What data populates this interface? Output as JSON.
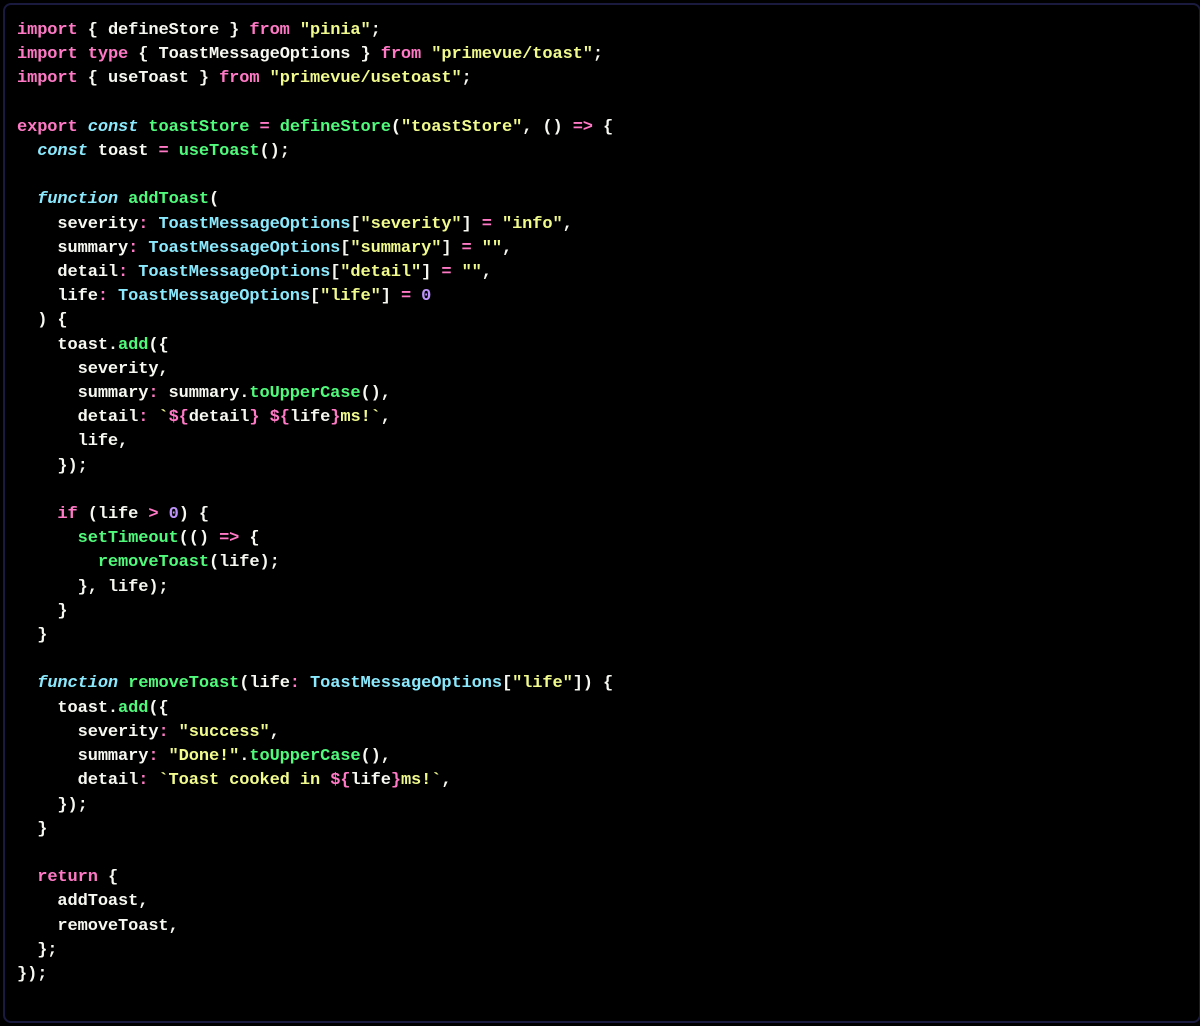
{
  "code": {
    "lines": [
      {
        "tokens": [
          {
            "t": "import",
            "c": "kw"
          },
          {
            "t": " { ",
            "c": "pun"
          },
          {
            "t": "defineStore",
            "c": "id"
          },
          {
            "t": " } ",
            "c": "pun"
          },
          {
            "t": "from",
            "c": "kw"
          },
          {
            "t": " ",
            "c": "pun"
          },
          {
            "t": "\"pinia\"",
            "c": "str"
          },
          {
            "t": ";",
            "c": "pun"
          }
        ]
      },
      {
        "tokens": [
          {
            "t": "import",
            "c": "kw"
          },
          {
            "t": " ",
            "c": "pun"
          },
          {
            "t": "type",
            "c": "kw"
          },
          {
            "t": " { ",
            "c": "pun"
          },
          {
            "t": "ToastMessageOptions",
            "c": "id"
          },
          {
            "t": " } ",
            "c": "pun"
          },
          {
            "t": "from",
            "c": "kw"
          },
          {
            "t": " ",
            "c": "pun"
          },
          {
            "t": "\"primevue/toast\"",
            "c": "str"
          },
          {
            "t": ";",
            "c": "pun"
          }
        ]
      },
      {
        "tokens": [
          {
            "t": "import",
            "c": "kw"
          },
          {
            "t": " { ",
            "c": "pun"
          },
          {
            "t": "useToast",
            "c": "id"
          },
          {
            "t": " } ",
            "c": "pun"
          },
          {
            "t": "from",
            "c": "kw"
          },
          {
            "t": " ",
            "c": "pun"
          },
          {
            "t": "\"primevue/usetoast\"",
            "c": "str"
          },
          {
            "t": ";",
            "c": "pun"
          }
        ]
      },
      {
        "tokens": [
          {
            "t": "",
            "c": "pun"
          }
        ]
      },
      {
        "tokens": [
          {
            "t": "export",
            "c": "kw"
          },
          {
            "t": " ",
            "c": "pun"
          },
          {
            "t": "const",
            "c": "sk"
          },
          {
            "t": " ",
            "c": "pun"
          },
          {
            "t": "toastStore",
            "c": "fn"
          },
          {
            "t": " ",
            "c": "pun"
          },
          {
            "t": "=",
            "c": "kw"
          },
          {
            "t": " ",
            "c": "pun"
          },
          {
            "t": "defineStore",
            "c": "fn"
          },
          {
            "t": "(",
            "c": "pun"
          },
          {
            "t": "\"toastStore\"",
            "c": "str"
          },
          {
            "t": ", () ",
            "c": "pun"
          },
          {
            "t": "=>",
            "c": "kw"
          },
          {
            "t": " {",
            "c": "pun"
          }
        ]
      },
      {
        "tokens": [
          {
            "t": "  ",
            "c": "pun"
          },
          {
            "t": "const",
            "c": "sk"
          },
          {
            "t": " ",
            "c": "pun"
          },
          {
            "t": "toast",
            "c": "id"
          },
          {
            "t": " ",
            "c": "pun"
          },
          {
            "t": "=",
            "c": "kw"
          },
          {
            "t": " ",
            "c": "pun"
          },
          {
            "t": "useToast",
            "c": "fn"
          },
          {
            "t": "();",
            "c": "pun"
          }
        ]
      },
      {
        "tokens": [
          {
            "t": "",
            "c": "pun"
          }
        ]
      },
      {
        "tokens": [
          {
            "t": "  ",
            "c": "pun"
          },
          {
            "t": "function",
            "c": "sk"
          },
          {
            "t": " ",
            "c": "pun"
          },
          {
            "t": "addToast",
            "c": "fn"
          },
          {
            "t": "(",
            "c": "pun"
          }
        ]
      },
      {
        "tokens": [
          {
            "t": "    severity",
            "c": "id"
          },
          {
            "t": ":",
            "c": "kw"
          },
          {
            "t": " ",
            "c": "pun"
          },
          {
            "t": "ToastMessageOptions",
            "c": "type"
          },
          {
            "t": "[",
            "c": "pun"
          },
          {
            "t": "\"severity\"",
            "c": "str"
          },
          {
            "t": "] ",
            "c": "pun"
          },
          {
            "t": "=",
            "c": "kw"
          },
          {
            "t": " ",
            "c": "pun"
          },
          {
            "t": "\"info\"",
            "c": "str"
          },
          {
            "t": ",",
            "c": "pun"
          }
        ]
      },
      {
        "tokens": [
          {
            "t": "    summary",
            "c": "id"
          },
          {
            "t": ":",
            "c": "kw"
          },
          {
            "t": " ",
            "c": "pun"
          },
          {
            "t": "ToastMessageOptions",
            "c": "type"
          },
          {
            "t": "[",
            "c": "pun"
          },
          {
            "t": "\"summary\"",
            "c": "str"
          },
          {
            "t": "] ",
            "c": "pun"
          },
          {
            "t": "=",
            "c": "kw"
          },
          {
            "t": " ",
            "c": "pun"
          },
          {
            "t": "\"\"",
            "c": "str"
          },
          {
            "t": ",",
            "c": "pun"
          }
        ]
      },
      {
        "tokens": [
          {
            "t": "    detail",
            "c": "id"
          },
          {
            "t": ":",
            "c": "kw"
          },
          {
            "t": " ",
            "c": "pun"
          },
          {
            "t": "ToastMessageOptions",
            "c": "type"
          },
          {
            "t": "[",
            "c": "pun"
          },
          {
            "t": "\"detail\"",
            "c": "str"
          },
          {
            "t": "] ",
            "c": "pun"
          },
          {
            "t": "=",
            "c": "kw"
          },
          {
            "t": " ",
            "c": "pun"
          },
          {
            "t": "\"\"",
            "c": "str"
          },
          {
            "t": ",",
            "c": "pun"
          }
        ]
      },
      {
        "tokens": [
          {
            "t": "    life",
            "c": "id"
          },
          {
            "t": ":",
            "c": "kw"
          },
          {
            "t": " ",
            "c": "pun"
          },
          {
            "t": "ToastMessageOptions",
            "c": "type"
          },
          {
            "t": "[",
            "c": "pun"
          },
          {
            "t": "\"life\"",
            "c": "str"
          },
          {
            "t": "] ",
            "c": "pun"
          },
          {
            "t": "=",
            "c": "kw"
          },
          {
            "t": " ",
            "c": "pun"
          },
          {
            "t": "0",
            "c": "num"
          }
        ]
      },
      {
        "tokens": [
          {
            "t": "  ) {",
            "c": "pun"
          }
        ]
      },
      {
        "tokens": [
          {
            "t": "    toast.",
            "c": "id"
          },
          {
            "t": "add",
            "c": "fn"
          },
          {
            "t": "({",
            "c": "pun"
          }
        ]
      },
      {
        "tokens": [
          {
            "t": "      severity,",
            "c": "id"
          }
        ]
      },
      {
        "tokens": [
          {
            "t": "      summary",
            "c": "id"
          },
          {
            "t": ":",
            "c": "kw"
          },
          {
            "t": " summary.",
            "c": "id"
          },
          {
            "t": "toUpperCase",
            "c": "fn"
          },
          {
            "t": "(),",
            "c": "pun"
          }
        ]
      },
      {
        "tokens": [
          {
            "t": "      detail",
            "c": "id"
          },
          {
            "t": ":",
            "c": "kw"
          },
          {
            "t": " ",
            "c": "pun"
          },
          {
            "t": "`",
            "c": "tpl"
          },
          {
            "t": "${",
            "c": "kw"
          },
          {
            "t": "detail",
            "c": "id"
          },
          {
            "t": "}",
            "c": "kw"
          },
          {
            "t": " ",
            "c": "tpl"
          },
          {
            "t": "${",
            "c": "kw"
          },
          {
            "t": "life",
            "c": "id"
          },
          {
            "t": "}",
            "c": "kw"
          },
          {
            "t": "ms!`",
            "c": "tpl"
          },
          {
            "t": ",",
            "c": "pun"
          }
        ]
      },
      {
        "tokens": [
          {
            "t": "      life,",
            "c": "id"
          }
        ]
      },
      {
        "tokens": [
          {
            "t": "    });",
            "c": "pun"
          }
        ]
      },
      {
        "tokens": [
          {
            "t": "",
            "c": "pun"
          }
        ]
      },
      {
        "tokens": [
          {
            "t": "    ",
            "c": "pun"
          },
          {
            "t": "if",
            "c": "kw"
          },
          {
            "t": " (life ",
            "c": "pun"
          },
          {
            "t": ">",
            "c": "kw"
          },
          {
            "t": " ",
            "c": "pun"
          },
          {
            "t": "0",
            "c": "num"
          },
          {
            "t": ") {",
            "c": "pun"
          }
        ]
      },
      {
        "tokens": [
          {
            "t": "      ",
            "c": "pun"
          },
          {
            "t": "setTimeout",
            "c": "fn"
          },
          {
            "t": "(() ",
            "c": "pun"
          },
          {
            "t": "=>",
            "c": "kw"
          },
          {
            "t": " {",
            "c": "pun"
          }
        ]
      },
      {
        "tokens": [
          {
            "t": "        ",
            "c": "pun"
          },
          {
            "t": "removeToast",
            "c": "fn"
          },
          {
            "t": "(life);",
            "c": "pun"
          }
        ]
      },
      {
        "tokens": [
          {
            "t": "      }, life);",
            "c": "pun"
          }
        ]
      },
      {
        "tokens": [
          {
            "t": "    }",
            "c": "pun"
          }
        ]
      },
      {
        "tokens": [
          {
            "t": "  }",
            "c": "pun"
          }
        ]
      },
      {
        "tokens": [
          {
            "t": "",
            "c": "pun"
          }
        ]
      },
      {
        "tokens": [
          {
            "t": "  ",
            "c": "pun"
          },
          {
            "t": "function",
            "c": "sk"
          },
          {
            "t": " ",
            "c": "pun"
          },
          {
            "t": "removeToast",
            "c": "fn"
          },
          {
            "t": "(life",
            "c": "pun"
          },
          {
            "t": ":",
            "c": "kw"
          },
          {
            "t": " ",
            "c": "pun"
          },
          {
            "t": "ToastMessageOptions",
            "c": "type"
          },
          {
            "t": "[",
            "c": "pun"
          },
          {
            "t": "\"life\"",
            "c": "str"
          },
          {
            "t": "]) {",
            "c": "pun"
          }
        ]
      },
      {
        "tokens": [
          {
            "t": "    toast.",
            "c": "id"
          },
          {
            "t": "add",
            "c": "fn"
          },
          {
            "t": "({",
            "c": "pun"
          }
        ]
      },
      {
        "tokens": [
          {
            "t": "      severity",
            "c": "id"
          },
          {
            "t": ":",
            "c": "kw"
          },
          {
            "t": " ",
            "c": "pun"
          },
          {
            "t": "\"success\"",
            "c": "str"
          },
          {
            "t": ",",
            "c": "pun"
          }
        ]
      },
      {
        "tokens": [
          {
            "t": "      summary",
            "c": "id"
          },
          {
            "t": ":",
            "c": "kw"
          },
          {
            "t": " ",
            "c": "pun"
          },
          {
            "t": "\"Done!\"",
            "c": "str"
          },
          {
            "t": ".",
            "c": "pun"
          },
          {
            "t": "toUpperCase",
            "c": "fn"
          },
          {
            "t": "(),",
            "c": "pun"
          }
        ]
      },
      {
        "tokens": [
          {
            "t": "      detail",
            "c": "id"
          },
          {
            "t": ":",
            "c": "kw"
          },
          {
            "t": " ",
            "c": "pun"
          },
          {
            "t": "`Toast cooked in ",
            "c": "tpl"
          },
          {
            "t": "${",
            "c": "kw"
          },
          {
            "t": "life",
            "c": "id"
          },
          {
            "t": "}",
            "c": "kw"
          },
          {
            "t": "ms!`",
            "c": "tpl"
          },
          {
            "t": ",",
            "c": "pun"
          }
        ]
      },
      {
        "tokens": [
          {
            "t": "    });",
            "c": "pun"
          }
        ]
      },
      {
        "tokens": [
          {
            "t": "  }",
            "c": "pun"
          }
        ]
      },
      {
        "tokens": [
          {
            "t": "",
            "c": "pun"
          }
        ]
      },
      {
        "tokens": [
          {
            "t": "  ",
            "c": "pun"
          },
          {
            "t": "return",
            "c": "kw"
          },
          {
            "t": " {",
            "c": "pun"
          }
        ]
      },
      {
        "tokens": [
          {
            "t": "    addToast,",
            "c": "id"
          }
        ]
      },
      {
        "tokens": [
          {
            "t": "    removeToast,",
            "c": "id"
          }
        ]
      },
      {
        "tokens": [
          {
            "t": "  };",
            "c": "pun"
          }
        ]
      },
      {
        "tokens": [
          {
            "t": "});",
            "c": "pun"
          }
        ]
      }
    ]
  }
}
